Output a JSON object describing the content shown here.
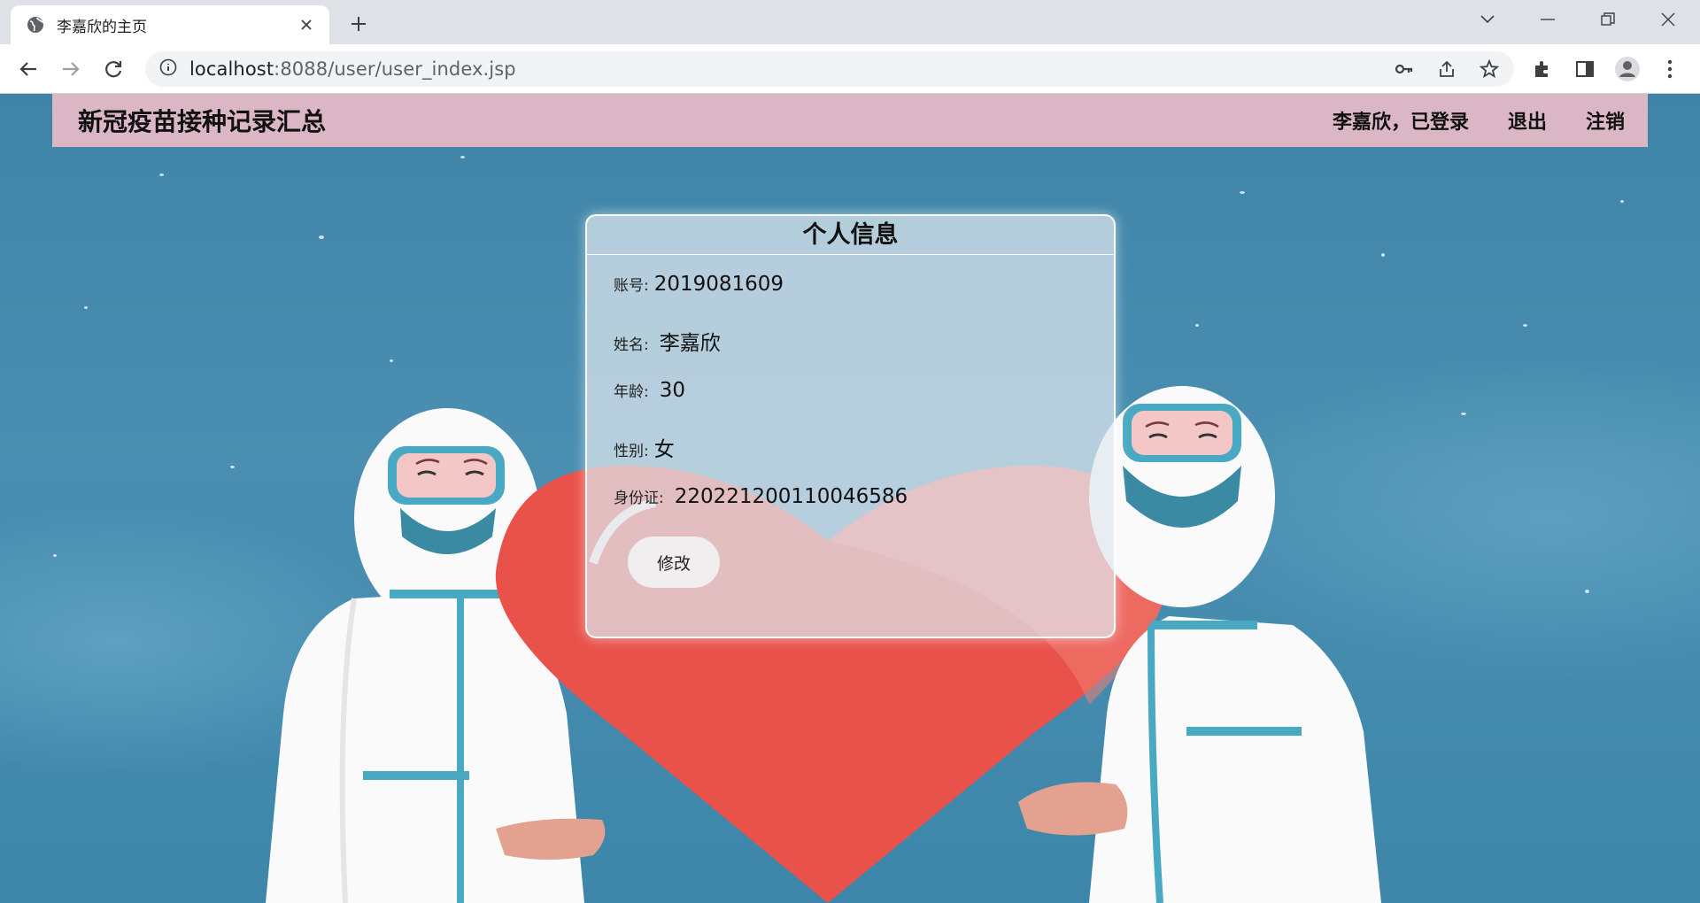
{
  "browser": {
    "tab_title": "李嘉欣的主页",
    "url_host": "localhost",
    "url_rest": ":8088/user/user_index.jsp"
  },
  "nav": {
    "brand": "新冠疫苗接种记录汇总",
    "status": "李嘉欣，已登录",
    "logout": "退出",
    "deregister": "注销"
  },
  "card": {
    "title": "个人信息",
    "fields": [
      {
        "label": "账号:",
        "value": "2019081609"
      },
      {
        "label": "姓名:",
        "value": "李嘉欣"
      },
      {
        "label": "年龄:",
        "value": "30"
      },
      {
        "label": "性别:",
        "value": "女"
      },
      {
        "label": "身份证:",
        "value": "220221200110046586"
      }
    ],
    "button": "修改"
  },
  "colors": {
    "navbar_bg": "#dbb6c4",
    "page_bg": "#4a8fb1",
    "heart": "#e8524a"
  }
}
